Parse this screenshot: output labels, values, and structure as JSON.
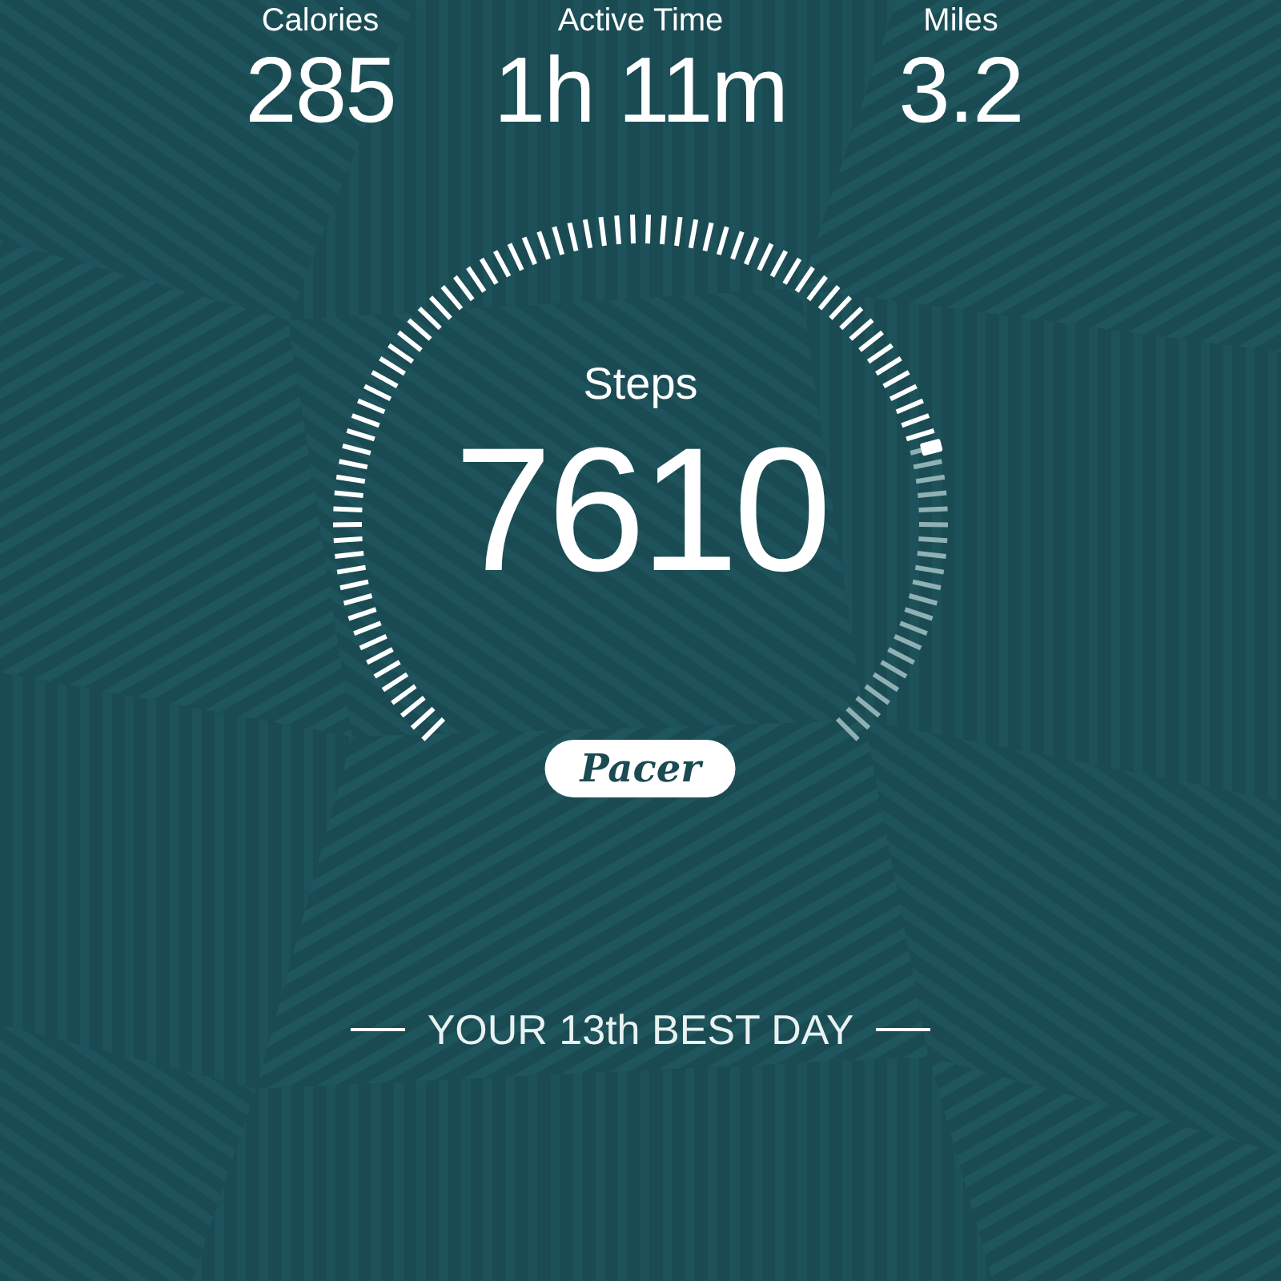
{
  "stats": [
    {
      "label": "Calories",
      "value": "285"
    },
    {
      "label": "Active Time",
      "value": "1h 11m"
    },
    {
      "label": "Miles",
      "value": "3.2"
    }
  ],
  "steps": {
    "label": "Steps",
    "value": "7610"
  },
  "badge": "Pacer",
  "rank_text": "YOUR 13th BEST DAY"
}
